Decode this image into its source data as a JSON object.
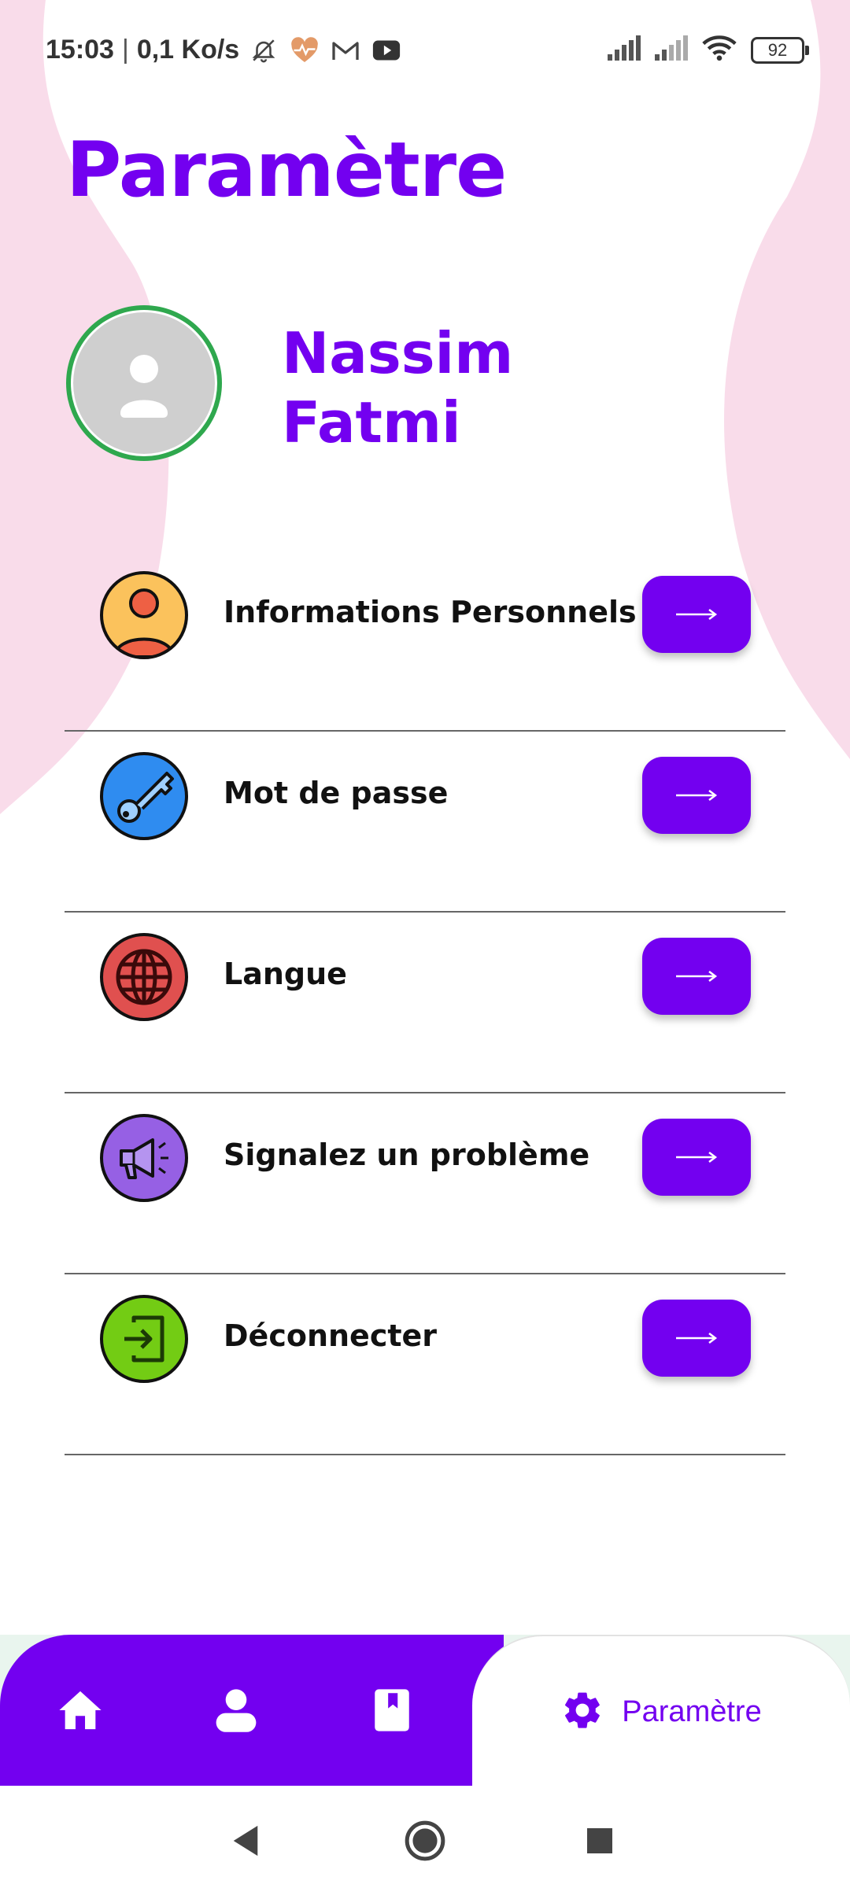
{
  "status_bar": {
    "time": "15:03",
    "separator": "|",
    "net_speed": "0,1 Ko/s",
    "battery": "92"
  },
  "page": {
    "title": "Paramètre"
  },
  "profile": {
    "first_name": "Nassim",
    "last_name": "Fatmi"
  },
  "menu": {
    "items": [
      {
        "label": "Informations Personnels",
        "icon": "user-icon",
        "color": "#fbc25c"
      },
      {
        "label": "Mot de passe",
        "icon": "key-icon",
        "color": "#2f8cf0"
      },
      {
        "label": "Langue",
        "icon": "globe-icon",
        "color": "#e0504f"
      },
      {
        "label": "Signalez un problème",
        "icon": "megaphone-icon",
        "color": "#9660e4"
      },
      {
        "label": "Déconnecter",
        "icon": "logout-icon",
        "color": "#73cc14"
      }
    ]
  },
  "bottom_nav": {
    "items": [
      {
        "icon": "home-icon"
      },
      {
        "icon": "profile-icon"
      },
      {
        "icon": "book-icon"
      }
    ],
    "active": {
      "icon": "gear-icon",
      "label": "Paramètre"
    }
  },
  "colors": {
    "accent": "#7300f0",
    "background_blob": "#f9dcea"
  }
}
